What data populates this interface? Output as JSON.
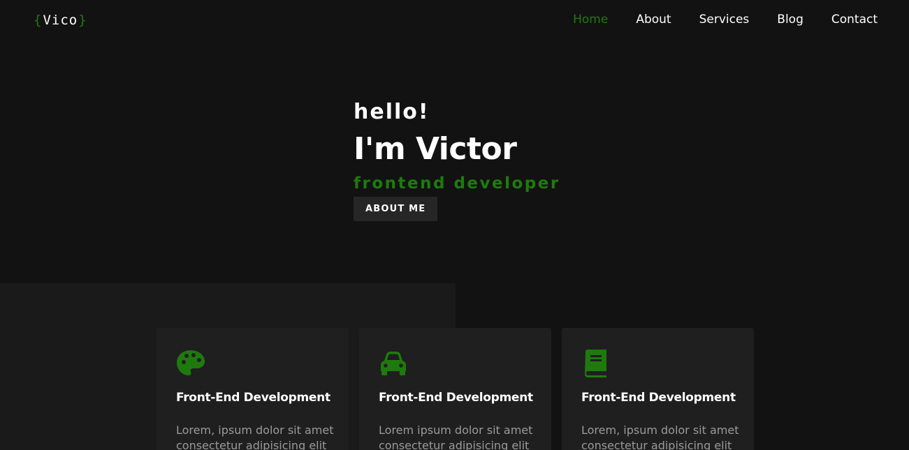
{
  "logo": {
    "open_brace": "{",
    "name": "Vico",
    "close_brace": "}"
  },
  "nav": {
    "items": [
      {
        "label": "Home",
        "active": true
      },
      {
        "label": "About",
        "active": false
      },
      {
        "label": "Services",
        "active": false
      },
      {
        "label": "Blog",
        "active": false
      },
      {
        "label": "Contact",
        "active": false
      }
    ]
  },
  "hero": {
    "greeting": "hello!",
    "name": "I'm Victor",
    "role": "frontend developer",
    "button_label": "ABOUT ME"
  },
  "services": {
    "cards": [
      {
        "icon": "palette-icon",
        "title": "Front-End Development",
        "text": "Lorem, ipsum dolor sit amet consectetur adipisicing elit"
      },
      {
        "icon": "car-icon",
        "title": "Front-End Development",
        "text": "Lorem ipsum dolor sit amet consectetur adipisicing elit"
      },
      {
        "icon": "book-icon",
        "title": "Front-End Development",
        "text": "Lorem, ipsum dolor sit amet consectetur adipisicing elit"
      }
    ]
  },
  "colors": {
    "accent": "#1f7a0e",
    "background": "#121212",
    "card": "#1f1f1f",
    "panel": "#1a1a1a",
    "button": "#262626"
  }
}
